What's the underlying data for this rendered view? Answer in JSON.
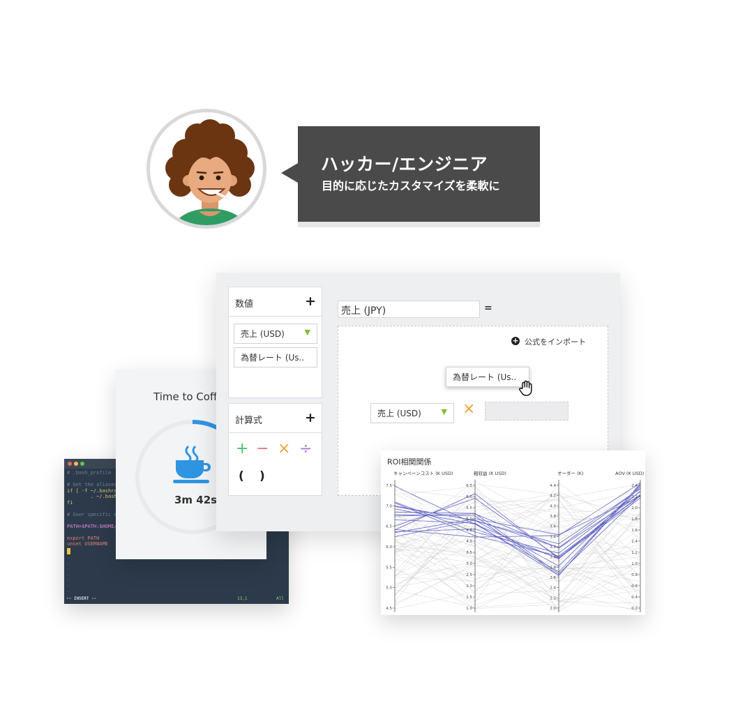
{
  "persona": {
    "title": "ハッカー/エンジニア",
    "subtitle": "目的に応じたカスタマイズを柔軟に"
  },
  "terminal": {
    "lines": [
      {
        "text": "# .bash_profile",
        "color": "#6f8299"
      },
      {
        "text": "",
        "color": "#6f8299"
      },
      {
        "text": "# Get the aliases",
        "color": "#6f8299"
      },
      {
        "text": "if [ -f ~/.bashrc",
        "color": "#e3c66c"
      },
      {
        "text": "        . ~/.bashrc",
        "color": "#e3c66c"
      },
      {
        "text": "fi",
        "color": "#e3c66c"
      },
      {
        "text": "",
        "color": "#6f8299"
      },
      {
        "text": "# User specific en",
        "color": "#6f8299"
      },
      {
        "text": "",
        "color": "#6f8299"
      },
      {
        "text": "PATH=$PATH:$HOME/",
        "color": "#e08bd3"
      },
      {
        "text": "",
        "color": "#6f8299"
      },
      {
        "text": "export PATH",
        "color": "#e0816a"
      },
      {
        "text": "unset USERNAME",
        "color": "#e0816a"
      }
    ],
    "mode": "-- INSERT --",
    "position": "13,1",
    "scroll": "All"
  },
  "coffee": {
    "title": "Time to Coffee",
    "time": "3m 42s",
    "icon": "coffee-cup-icon",
    "accent": "#2f95e3",
    "progress": 0.24
  },
  "editor": {
    "numbers_panel": {
      "title": "数値",
      "items": [
        {
          "label": "売上 (USD)",
          "has_filter": true
        },
        {
          "label": "為替レート (Us..",
          "has_filter": false
        }
      ]
    },
    "formula_panel": {
      "title": "計算式",
      "operators": [
        {
          "symbol": "+",
          "color": "#4cbf73"
        },
        {
          "symbol": "−",
          "color": "#e8777a"
        },
        {
          "symbol": "×",
          "color": "#efa03a"
        },
        {
          "symbol": "÷",
          "color": "#a87ad6"
        }
      ],
      "open_paren": "(",
      "close_paren": ")"
    },
    "field_name": "売上 (JPY)",
    "equals": "=",
    "import_label": "公式をインポート",
    "dragging_chip": "為替レート (Us..",
    "operand": "売上 (USD)",
    "operator": "×"
  },
  "roi_chart": {
    "title": "ROI相関関係",
    "axes": [
      {
        "label": "キャンペーンコスト (K USD)",
        "ticks": [
          "7.5",
          "7.0",
          "6.5",
          "6.0",
          "5.5",
          "5.0",
          "4.5"
        ],
        "min": 4.3,
        "max": 7.8
      },
      {
        "label": "粗収益 (K USD)",
        "ticks": [
          "6.5",
          "6.0",
          "5.5",
          "5.0",
          "4.5",
          "4.0",
          "3.5",
          "3.0",
          "2.5",
          "2.0",
          "1.5",
          "1.0"
        ],
        "min": 1.0,
        "max": 6.9
      },
      {
        "label": "オーダー (K)",
        "ticks": [
          "4.4",
          "4.2",
          "4.0",
          "3.8",
          "3.6",
          "3.4",
          "3.2",
          "3.0",
          "2.8",
          "2.6",
          "2.4",
          "2.2",
          "2.0"
        ],
        "min": 2.0,
        "max": 4.4
      },
      {
        "label": "AOV (K USD)",
        "ticks": [
          "2.4",
          "2.2",
          "2.0",
          "1.8",
          "1.6",
          "1.4",
          "1.2",
          "1.0",
          "0.8",
          "0.6",
          "0.4",
          "0.2"
        ],
        "min": 0.1,
        "max": 2.5
      }
    ],
    "highlight_color": "#5a5dc4",
    "base_color": "#c9c9c9"
  }
}
